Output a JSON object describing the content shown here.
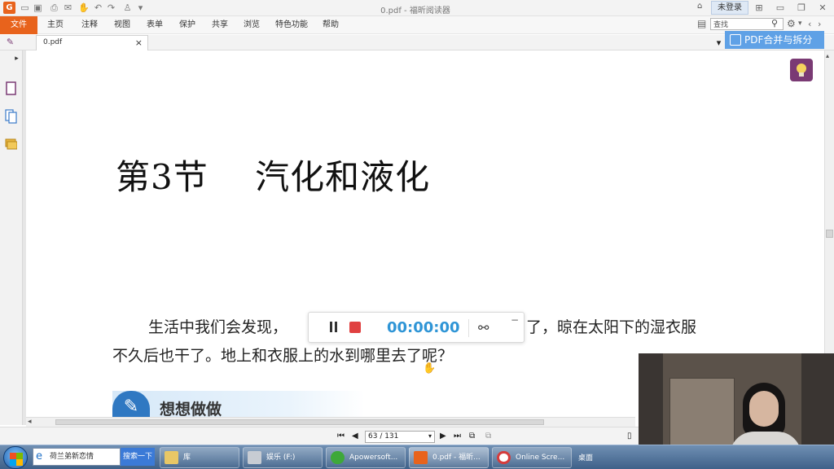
{
  "window": {
    "title": "0.pdf - 福昕阅读器",
    "login_label": "未登录"
  },
  "menu": {
    "file": "文件",
    "items": [
      "主页",
      "注释",
      "视图",
      "表单",
      "保护",
      "共享",
      "浏览",
      "特色功能",
      "帮助"
    ]
  },
  "search": {
    "value": "查找"
  },
  "tab": {
    "label": "0.pdf",
    "close": "×"
  },
  "promo": {
    "label": "PDF合并与拆分"
  },
  "document": {
    "heading": "第3节    汽化和液化",
    "para_line1_left": "生活中我们会发现，",
    "para_line1_right": "了，晾在太阳下的湿衣服",
    "para_line2": "不久后也干了。地上和衣服上的水到哪里去了呢？",
    "section_label": "想想做做"
  },
  "recorder": {
    "time": "00:00:00",
    "minimize": "−"
  },
  "statusbar": {
    "page_display": "63 / 131"
  },
  "taskbar": {
    "search_value": "荷兰弟新恋情",
    "search_button": "搜索一下",
    "items": [
      "库",
      "娱乐 (F:)",
      "Apowersoft...",
      "0.pdf - 福昕...",
      "Online Scre..."
    ],
    "desktop_label": "桌面"
  },
  "colors": {
    "accent": "#e8631c",
    "promo": "#5fa1e6",
    "recorder_time": "#2f95d6",
    "stop": "#e04040"
  }
}
